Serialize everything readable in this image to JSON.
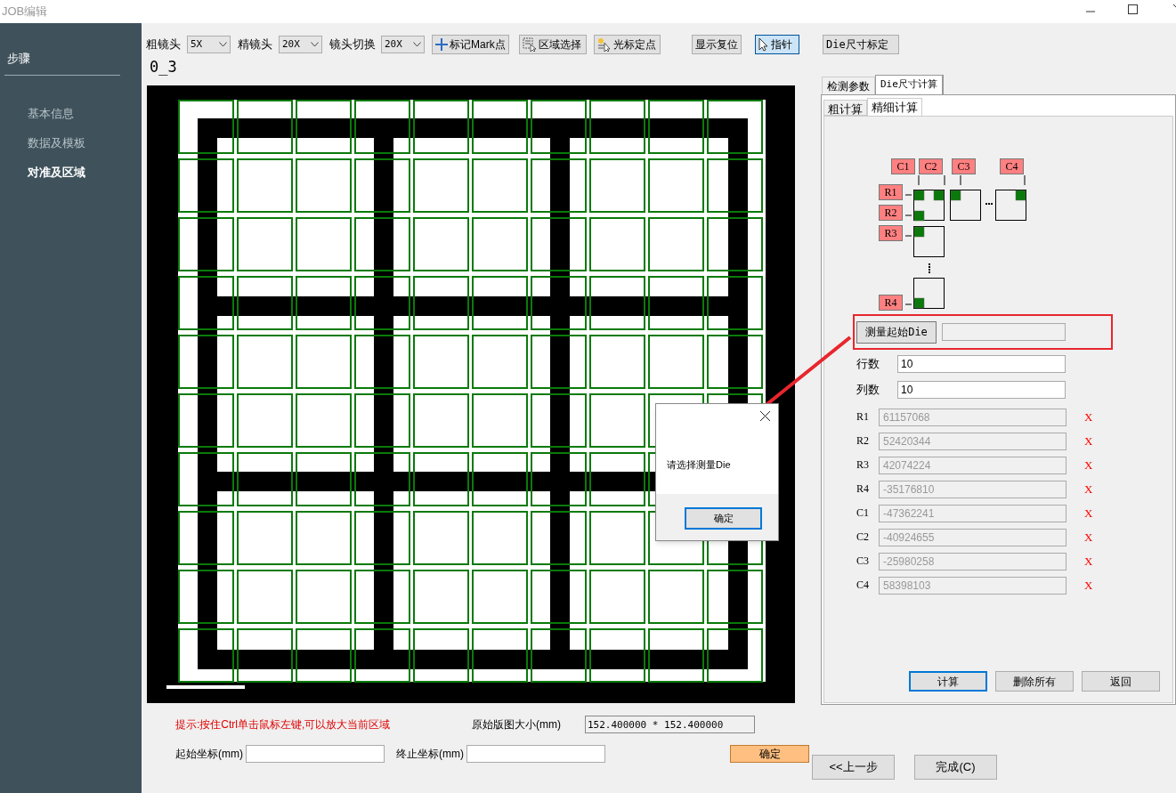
{
  "window": {
    "title": "JOB编辑"
  },
  "sidebar": {
    "heading": "步骤",
    "items": [
      {
        "label": "基本信息",
        "selected": false
      },
      {
        "label": "数据及模板",
        "selected": false
      },
      {
        "label": "对准及区域",
        "selected": true
      }
    ]
  },
  "toolbar": {
    "lenses": [
      {
        "label": "粗镜头",
        "value": "5X"
      },
      {
        "label": "精镜头",
        "value": "20X"
      },
      {
        "label": "镜头切换",
        "value": "20X"
      }
    ],
    "buttons": [
      {
        "label": "标记Mark点",
        "selected": false
      },
      {
        "label": "区域选择",
        "selected": false
      },
      {
        "label": "光标定点",
        "selected": false
      },
      {
        "label": "显示复位",
        "selected": false
      },
      {
        "label": "指针",
        "selected": true
      },
      {
        "label": "Die尺寸标定",
        "selected": false
      }
    ]
  },
  "image_label": "0_3",
  "tabs": [
    {
      "label": "检测参数",
      "selected": false
    },
    {
      "label": "Die尺寸计算",
      "selected": true
    }
  ],
  "subtabs": [
    {
      "label": "粗计算",
      "selected": false
    },
    {
      "label": "精细计算",
      "selected": true
    }
  ],
  "diagram": {
    "columns": [
      "C1",
      "C2",
      "C3",
      "C4"
    ],
    "rows": [
      "R1",
      "R2",
      "R3",
      "R4"
    ]
  },
  "measure": {
    "button": "测量起始Die"
  },
  "counts": [
    {
      "label": "行数",
      "value": "10"
    },
    {
      "label": "列数",
      "value": "10"
    }
  ],
  "readings": [
    {
      "label": "R1",
      "value": "61157068",
      "disabled": true,
      "clear": "X"
    },
    {
      "label": "R2",
      "value": "52420344",
      "disabled": true,
      "clear": "X"
    },
    {
      "label": "R3",
      "value": "42074224",
      "disabled": true,
      "clear": "X"
    },
    {
      "label": "R4",
      "value": "-35176810",
      "disabled": true,
      "clear": "X"
    },
    {
      "label": "C1",
      "value": "-47362241",
      "disabled": true,
      "clear": "X"
    },
    {
      "label": "C2",
      "value": "-40924655",
      "disabled": true,
      "clear": "X"
    },
    {
      "label": "C3",
      "value": "-25980258",
      "disabled": true,
      "clear": "X"
    },
    {
      "label": "C4",
      "value": "58398103",
      "disabled": true,
      "clear": "X"
    }
  ],
  "actions": [
    {
      "label": "计算",
      "default": true
    },
    {
      "label": "删除所有",
      "default": false
    },
    {
      "label": "返回",
      "default": false
    }
  ],
  "hint": "提示:按住Ctrl单击鼠标左键,可以放大当前区域",
  "original_size": {
    "label": "原始版图大小(mm)",
    "value": "152.400000 * 152.400000"
  },
  "coords": [
    {
      "label": "起始坐标(mm)"
    },
    {
      "label": "终止坐标(mm)"
    }
  ],
  "confirm_button": "确定",
  "nav_buttons": [
    "<<上一步",
    "完成(C)"
  ],
  "dialog": {
    "message": "请选择测量Die",
    "ok": "确定"
  }
}
